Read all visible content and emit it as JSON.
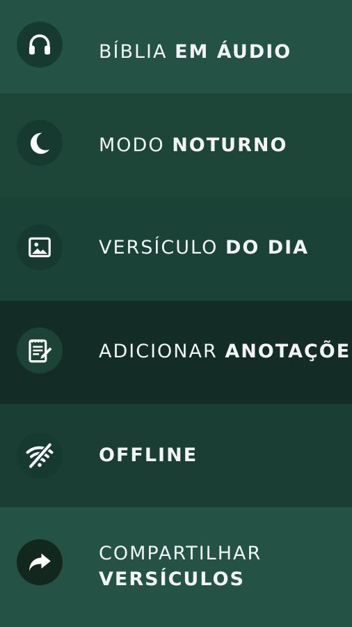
{
  "menu": {
    "items": [
      {
        "light": "BÍBLIA",
        "bold": "EM ÁUDIO",
        "icon": "headphones-icon"
      },
      {
        "light": "MODO",
        "bold": "NOTURNO",
        "icon": "moon-stars-icon"
      },
      {
        "light": "VERSÍCULO",
        "bold": "DO DIA",
        "icon": "image-icon"
      },
      {
        "light": "ADICIONAR",
        "bold": "ANOTAÇÕES",
        "icon": "notepad-pencil-icon"
      },
      {
        "light": "",
        "bold": "OFFLINE",
        "icon": "wifi-off-icon"
      },
      {
        "light": "COMPARTILHAR",
        "bold": "VERSÍCULOS",
        "icon": "share-arrow-icon"
      }
    ]
  },
  "colors": {
    "text": "#f2f5f3",
    "row_dark": "#132c25",
    "row_green": "#245244"
  }
}
